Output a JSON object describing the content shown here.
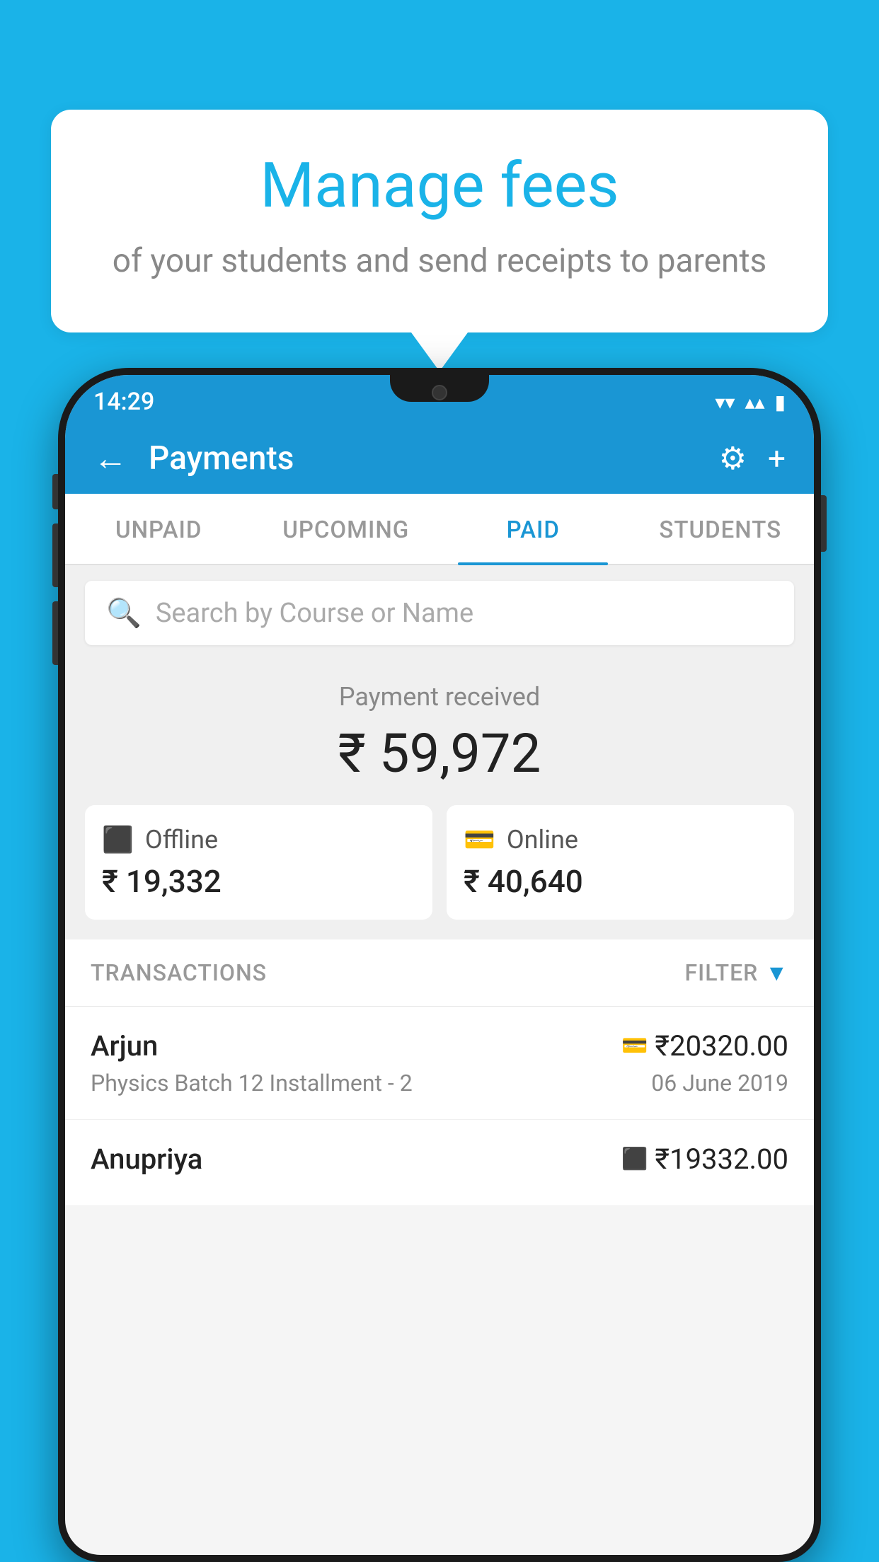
{
  "background_color": "#1ab3e8",
  "bubble": {
    "title": "Manage fees",
    "subtitle": "of your students and send receipts to parents"
  },
  "status_bar": {
    "time": "14:29",
    "wifi": "▾",
    "signal": "▴▴",
    "battery": "▮"
  },
  "header": {
    "title": "Payments",
    "back_label": "←",
    "settings_label": "⚙",
    "add_label": "+"
  },
  "tabs": [
    {
      "label": "UNPAID",
      "active": false
    },
    {
      "label": "UPCOMING",
      "active": false
    },
    {
      "label": "PAID",
      "active": true
    },
    {
      "label": "STUDENTS",
      "active": false
    }
  ],
  "search": {
    "placeholder": "Search by Course or Name"
  },
  "payment_received": {
    "label": "Payment received",
    "amount": "₹ 59,972"
  },
  "payment_cards": [
    {
      "type": "Offline",
      "amount": "₹ 19,332",
      "icon": "💳"
    },
    {
      "type": "Online",
      "amount": "₹ 40,640",
      "icon": "💳"
    }
  ],
  "transactions_section": {
    "label": "TRANSACTIONS",
    "filter_label": "FILTER"
  },
  "transactions": [
    {
      "name": "Arjun",
      "course": "Physics Batch 12 Installment - 2",
      "amount": "₹20320.00",
      "date": "06 June 2019",
      "icon": "💳"
    },
    {
      "name": "Anupriya",
      "course": "",
      "amount": "₹19332.00",
      "date": "",
      "icon": "💳"
    }
  ]
}
